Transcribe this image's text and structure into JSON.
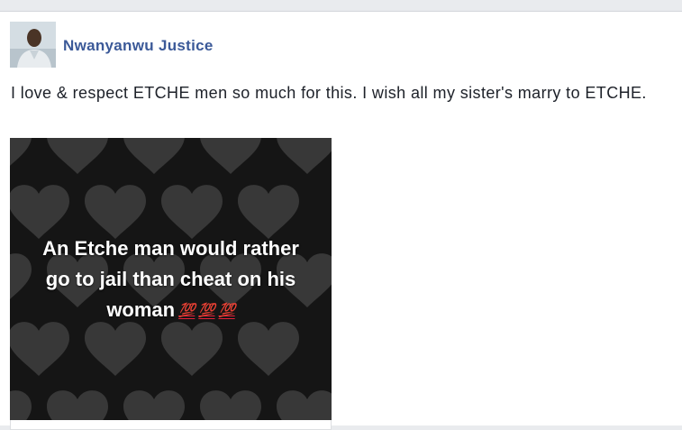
{
  "post": {
    "author": "Nwanyanwu Justice",
    "text": "I love & respect ETCHE men so much for this. I wish all my sister's marry to ETCHE.",
    "image": {
      "caption_line1": "An Etche man would rather",
      "caption_line2": "go to jail than cheat on his",
      "caption_line3": "woman",
      "emojis": [
        "💯",
        "💯",
        "💯"
      ]
    }
  }
}
